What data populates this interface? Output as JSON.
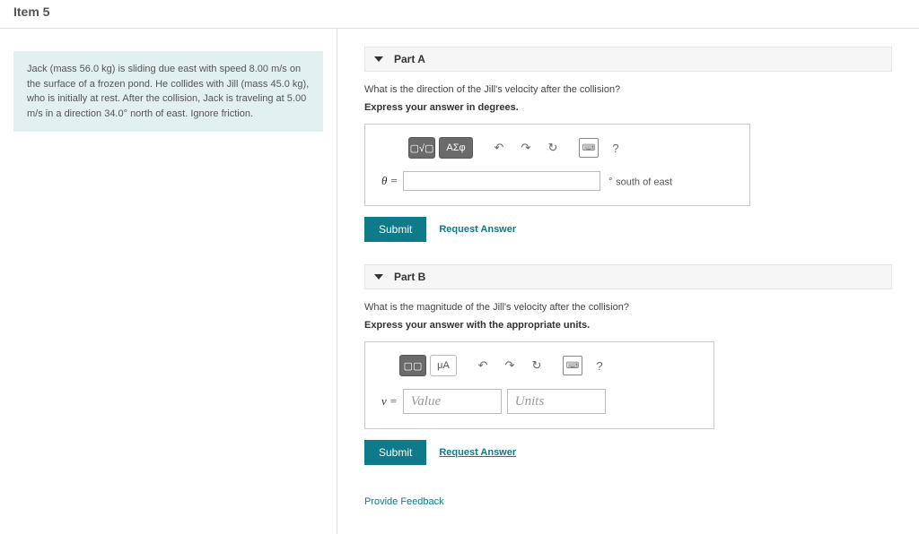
{
  "item_title": "Item 5",
  "problem_text": "Jack (mass 56.0 kg) is sliding due east with speed 8.00 m/s on the surface of a frozen pond. He collides with Jill (mass 45.0 kg), who is initially at rest. After the collision, Jack is traveling at 5.00 m/s in a direction 34.0° north of east. Ignore friction.",
  "partA": {
    "label": "Part A",
    "question": "What is the direction of the Jill's velocity after the collision?",
    "instruction": "Express your answer in degrees.",
    "variable": "θ =",
    "unit_suffix": "south of east",
    "submit": "Submit",
    "request": "Request Answer",
    "toolbar": {
      "template": "▢√▢",
      "symbols": "ΑΣφ",
      "undo": "↶",
      "redo": "↷",
      "reset": "↻",
      "keyboard": "⌨",
      "help": "?"
    }
  },
  "partB": {
    "label": "Part B",
    "question": "What is the magnitude of the Jill's velocity after the collision?",
    "instruction": "Express your answer with the appropriate units.",
    "variable": "v =",
    "value_placeholder": "Value",
    "units_placeholder": "Units",
    "submit": "Submit",
    "request": "Request Answer",
    "toolbar": {
      "template": "▢▢",
      "units": "μA",
      "undo": "↶",
      "redo": "↷",
      "reset": "↻",
      "keyboard": "⌨",
      "help": "?"
    }
  },
  "feedback": "Provide Feedback"
}
